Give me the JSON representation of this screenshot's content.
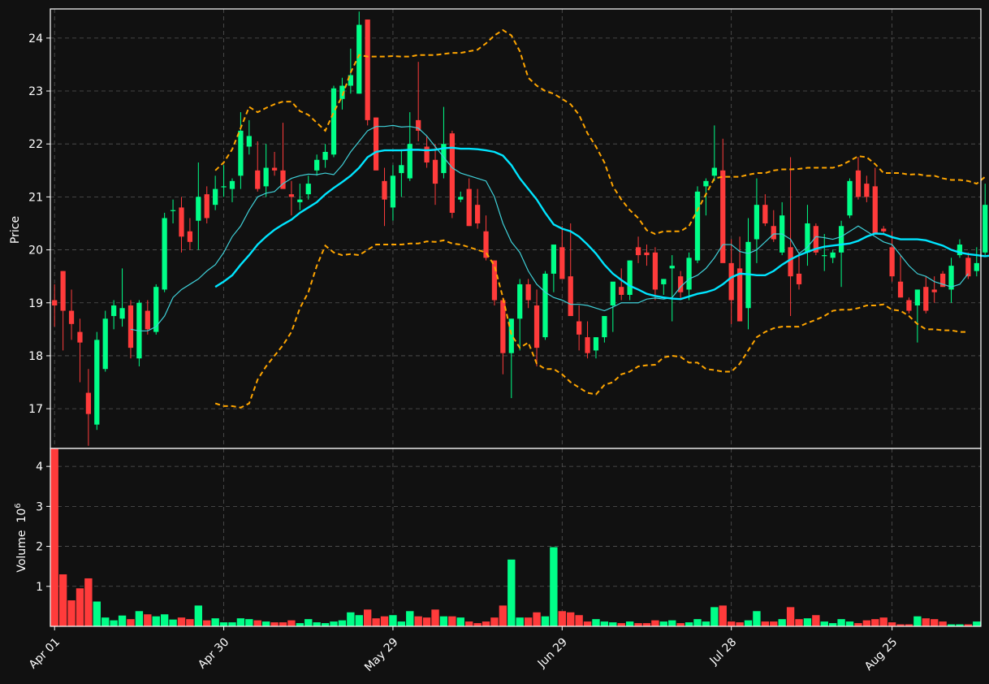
{
  "chart_data": [
    {
      "type": "candlestick",
      "panel": "price",
      "ylabel": "Price",
      "ylim": [
        16.25,
        24.55
      ],
      "yticks": [
        17,
        18,
        19,
        20,
        21,
        22,
        23,
        24
      ],
      "xlim": [
        -0.5,
        109.5
      ],
      "xtick_positions": [
        0,
        20,
        40,
        60,
        80,
        99
      ],
      "xtick_labels": [
        "Apr 01",
        "Apr 30",
        "May 29",
        "Jun 29",
        "Jul 28",
        "Aug 25"
      ],
      "grid": true,
      "colors": {
        "up": "#00ff88",
        "down": "#ff3b3b",
        "ma_fast": "#3fd0d8",
        "ma_slow": "#00e5ff",
        "bands": "#ffa500",
        "background": "#111111",
        "grid": "#555555"
      },
      "ohlc": [
        [
          19.05,
          19.35,
          18.55,
          18.95
        ],
        [
          19.6,
          19.6,
          18.1,
          18.85
        ],
        [
          18.85,
          19.25,
          18.3,
          18.6
        ],
        [
          18.45,
          18.7,
          17.5,
          18.25
        ],
        [
          17.3,
          17.75,
          16.3,
          16.9
        ],
        [
          16.7,
          18.45,
          16.6,
          18.3
        ],
        [
          17.75,
          18.85,
          17.7,
          18.7
        ],
        [
          18.75,
          19.05,
          18.5,
          18.95
        ],
        [
          18.7,
          19.65,
          18.55,
          18.9
        ],
        [
          18.95,
          19.05,
          17.95,
          18.15
        ],
        [
          17.95,
          19.05,
          17.8,
          19.0
        ],
        [
          18.85,
          19.05,
          18.4,
          18.5
        ],
        [
          18.45,
          19.35,
          18.4,
          19.3
        ],
        [
          19.25,
          20.7,
          19.2,
          20.6
        ],
        [
          20.75,
          20.95,
          20.5,
          20.75
        ],
        [
          20.8,
          21.0,
          19.95,
          20.25
        ],
        [
          20.35,
          20.6,
          20.0,
          20.15
        ],
        [
          20.55,
          21.65,
          20.0,
          21.0
        ],
        [
          21.05,
          21.2,
          20.5,
          20.6
        ],
        [
          20.85,
          21.4,
          20.75,
          21.15
        ],
        [
          21.2,
          21.6,
          21.0,
          21.2
        ],
        [
          21.15,
          21.35,
          20.9,
          21.3
        ],
        [
          21.4,
          22.6,
          21.15,
          22.25
        ],
        [
          21.95,
          22.45,
          21.8,
          22.15
        ],
        [
          21.5,
          22.05,
          21.1,
          21.15
        ],
        [
          21.2,
          22.0,
          21.0,
          21.55
        ],
        [
          21.55,
          21.85,
          21.4,
          21.5
        ],
        [
          21.5,
          22.4,
          21.2,
          21.15
        ],
        [
          21.05,
          21.3,
          20.65,
          21.0
        ],
        [
          20.9,
          21.25,
          20.75,
          20.95
        ],
        [
          21.05,
          21.4,
          20.95,
          21.25
        ],
        [
          21.5,
          21.8,
          21.4,
          21.7
        ],
        [
          21.7,
          22.0,
          21.55,
          21.85
        ],
        [
          21.8,
          23.1,
          21.75,
          23.05
        ],
        [
          22.85,
          23.25,
          22.65,
          23.1
        ],
        [
          23.1,
          23.8,
          22.95,
          23.3
        ],
        [
          22.95,
          24.5,
          22.95,
          24.25
        ],
        [
          24.35,
          24.35,
          22.35,
          22.45
        ],
        [
          22.5,
          22.5,
          21.5,
          21.5
        ],
        [
          21.3,
          21.55,
          20.45,
          20.95
        ],
        [
          20.8,
          21.6,
          20.55,
          21.4
        ],
        [
          21.45,
          21.9,
          21.0,
          21.6
        ],
        [
          21.35,
          22.6,
          21.3,
          22.0
        ],
        [
          22.45,
          23.55,
          22.05,
          22.25
        ],
        [
          21.95,
          22.15,
          21.55,
          21.65
        ],
        [
          21.7,
          22.0,
          20.85,
          21.25
        ],
        [
          21.45,
          22.7,
          21.35,
          22.0
        ],
        [
          22.2,
          22.25,
          20.6,
          20.7
        ],
        [
          20.95,
          21.1,
          20.9,
          21.0
        ],
        [
          21.15,
          21.35,
          20.45,
          20.45
        ],
        [
          20.85,
          21.15,
          20.4,
          20.5
        ],
        [
          20.35,
          20.65,
          19.8,
          19.85
        ],
        [
          19.8,
          19.8,
          18.95,
          19.05
        ],
        [
          19.05,
          19.1,
          17.65,
          18.05
        ],
        [
          18.05,
          18.7,
          17.2,
          18.7
        ],
        [
          18.7,
          19.45,
          18.1,
          19.35
        ],
        [
          19.35,
          19.45,
          18.9,
          19.05
        ],
        [
          18.95,
          19.25,
          17.8,
          18.15
        ],
        [
          18.35,
          19.6,
          18.3,
          19.55
        ],
        [
          19.55,
          20.1,
          19.2,
          20.1
        ],
        [
          20.05,
          20.45,
          19.45,
          19.45
        ],
        [
          19.5,
          20.5,
          19.25,
          18.75
        ],
        [
          18.65,
          18.95,
          18.1,
          18.4
        ],
        [
          18.35,
          18.65,
          17.95,
          18.05
        ],
        [
          18.1,
          18.35,
          17.95,
          18.35
        ],
        [
          18.35,
          18.75,
          18.25,
          18.75
        ],
        [
          18.95,
          19.35,
          18.45,
          19.4
        ],
        [
          19.3,
          19.65,
          19.05,
          19.15
        ],
        [
          19.15,
          19.8,
          19.05,
          19.8
        ],
        [
          20.05,
          20.25,
          19.75,
          19.9
        ],
        [
          19.95,
          20.1,
          19.7,
          19.9
        ],
        [
          19.95,
          20.05,
          19.05,
          19.25
        ],
        [
          19.35,
          19.45,
          19.15,
          19.45
        ],
        [
          19.65,
          19.9,
          18.65,
          19.7
        ],
        [
          19.5,
          19.6,
          19.05,
          19.2
        ],
        [
          19.25,
          19.95,
          19.05,
          19.85
        ],
        [
          19.8,
          21.2,
          19.75,
          21.1
        ],
        [
          21.2,
          21.35,
          20.65,
          21.3
        ],
        [
          21.4,
          22.35,
          21.3,
          21.55
        ],
        [
          21.5,
          22.1,
          19.95,
          19.75
        ],
        [
          19.75,
          20.2,
          18.6,
          19.05
        ],
        [
          19.65,
          20.25,
          18.65,
          18.65
        ],
        [
          18.9,
          20.6,
          18.5,
          20.15
        ],
        [
          20.2,
          21.35,
          19.75,
          20.85
        ],
        [
          20.85,
          21.05,
          20.45,
          20.5
        ],
        [
          20.45,
          20.75,
          20.15,
          20.2
        ],
        [
          19.95,
          20.9,
          19.9,
          20.65
        ],
        [
          20.05,
          21.75,
          18.75,
          19.5
        ],
        [
          19.55,
          19.95,
          19.25,
          19.35
        ],
        [
          19.95,
          20.85,
          19.7,
          20.5
        ],
        [
          20.45,
          20.5,
          19.9,
          19.95
        ],
        [
          19.9,
          20.3,
          19.6,
          19.9
        ],
        [
          19.85,
          20.0,
          19.75,
          19.95
        ],
        [
          19.95,
          20.55,
          19.3,
          20.45
        ],
        [
          20.65,
          21.35,
          20.6,
          21.3
        ],
        [
          21.5,
          21.75,
          20.95,
          21.0
        ],
        [
          21.25,
          21.4,
          20.9,
          21.0
        ],
        [
          21.2,
          21.55,
          20.35,
          20.3
        ],
        [
          20.4,
          20.45,
          20.3,
          20.35
        ],
        [
          20.05,
          20.35,
          19.4,
          19.5
        ],
        [
          19.4,
          19.9,
          19.1,
          19.1
        ],
        [
          19.05,
          19.1,
          18.8,
          18.85
        ],
        [
          18.95,
          19.25,
          18.25,
          19.25
        ],
        [
          19.3,
          19.5,
          18.8,
          18.85
        ],
        [
          19.25,
          19.5,
          19.0,
          19.2
        ],
        [
          19.55,
          19.6,
          19.3,
          19.3
        ],
        [
          19.25,
          19.85,
          19.0,
          19.7
        ],
        [
          19.9,
          20.2,
          19.85,
          20.1
        ],
        [
          19.85,
          19.95,
          19.45,
          19.5
        ],
        [
          19.6,
          20.05,
          19.5,
          19.75
        ],
        [
          19.95,
          21.25,
          19.9,
          20.85
        ]
      ],
      "ma_fast": [
        null,
        null,
        null,
        null,
        null,
        null,
        null,
        null,
        null,
        18.5,
        18.47,
        18.47,
        18.55,
        18.75,
        19.1,
        19.25,
        19.35,
        19.45,
        19.6,
        19.72,
        19.95,
        20.25,
        20.45,
        20.75,
        21.0,
        21.07,
        21.1,
        21.25,
        21.35,
        21.4,
        21.43,
        21.42,
        21.45,
        21.42,
        21.6,
        21.85,
        22.05,
        22.25,
        22.33,
        22.33,
        22.35,
        22.32,
        22.33,
        22.3,
        22.15,
        21.95,
        21.75,
        21.55,
        21.45,
        21.4,
        21.35,
        21.3,
        21.0,
        20.5,
        20.15,
        19.95,
        19.6,
        19.35,
        19.2,
        19.1,
        19.05,
        18.97,
        18.97,
        18.95,
        18.9,
        18.85,
        18.92,
        19.0,
        19.0,
        19.0,
        19.07,
        19.09,
        19.07,
        19.1,
        19.3,
        19.45,
        19.52,
        19.65,
        19.85,
        20.1,
        20.1,
        19.97,
        19.93,
        20.0,
        20.15,
        20.3,
        20.3,
        20.2,
        19.93,
        20.05,
        20.25,
        20.23,
        20.2,
        20.25,
        20.35,
        20.45,
        20.35,
        20.25,
        20.15,
        20.1,
        19.9,
        19.7,
        19.55,
        19.5,
        19.4,
        19.35,
        19.3,
        19.35,
        19.55
      ],
      "ma_slow": [
        null,
        null,
        null,
        null,
        null,
        null,
        null,
        null,
        null,
        null,
        null,
        null,
        null,
        null,
        null,
        null,
        null,
        null,
        null,
        19.3,
        19.4,
        19.52,
        19.72,
        19.9,
        20.1,
        20.25,
        20.38,
        20.48,
        20.57,
        20.7,
        20.8,
        20.9,
        21.05,
        21.17,
        21.28,
        21.4,
        21.55,
        21.75,
        21.85,
        21.88,
        21.88,
        21.88,
        21.89,
        21.89,
        21.88,
        21.89,
        21.92,
        21.93,
        21.91,
        21.91,
        21.9,
        21.88,
        21.85,
        21.78,
        21.6,
        21.35,
        21.15,
        20.95,
        20.7,
        20.48,
        20.4,
        20.35,
        20.25,
        20.1,
        19.93,
        19.72,
        19.55,
        19.43,
        19.32,
        19.25,
        19.17,
        19.13,
        19.1,
        19.08,
        19.07,
        19.12,
        19.17,
        19.2,
        19.25,
        19.35,
        19.48,
        19.55,
        19.54,
        19.52,
        19.52,
        19.6,
        19.72,
        19.82,
        19.9,
        19.96,
        20.02,
        20.06,
        20.08,
        20.1,
        20.12,
        20.17,
        20.25,
        20.31,
        20.3,
        20.24,
        20.2,
        20.2,
        20.2,
        20.18,
        20.13,
        20.08,
        20.0,
        19.95,
        19.92,
        19.9,
        19.88,
        19.9,
        19.85,
        19.88
      ],
      "band_upper": [
        null,
        null,
        null,
        null,
        null,
        null,
        null,
        null,
        null,
        null,
        null,
        null,
        null,
        null,
        null,
        null,
        null,
        null,
        null,
        21.5,
        21.65,
        21.9,
        22.3,
        22.7,
        22.6,
        22.68,
        22.75,
        22.8,
        22.8,
        22.62,
        22.55,
        22.4,
        22.25,
        22.6,
        22.9,
        23.35,
        23.68,
        23.65,
        23.65,
        23.65,
        23.66,
        23.65,
        23.65,
        23.68,
        23.68,
        23.68,
        23.7,
        23.72,
        23.72,
        23.75,
        23.78,
        23.9,
        24.05,
        24.15,
        24.05,
        23.75,
        23.25,
        23.1,
        23.0,
        22.95,
        22.85,
        22.75,
        22.55,
        22.2,
        21.95,
        21.65,
        21.2,
        20.95,
        20.75,
        20.6,
        20.37,
        20.3,
        20.35,
        20.35,
        20.35,
        20.45,
        20.75,
        21.05,
        21.35,
        21.38,
        21.38,
        21.38,
        21.42,
        21.45,
        21.45,
        21.5,
        21.52,
        21.52,
        21.53,
        21.55,
        21.55,
        21.55,
        21.55,
        21.6,
        21.68,
        21.77,
        21.75,
        21.62,
        21.45,
        21.45,
        21.45,
        21.42,
        21.43,
        21.4,
        21.4,
        21.35,
        21.32,
        21.32,
        21.3,
        21.25,
        21.38
      ],
      "band_lower": [
        null,
        null,
        null,
        null,
        null,
        null,
        null,
        null,
        null,
        null,
        null,
        null,
        null,
        null,
        null,
        null,
        null,
        null,
        null,
        17.1,
        17.05,
        17.05,
        17.02,
        17.1,
        17.55,
        17.8,
        18.0,
        18.2,
        18.45,
        18.9,
        19.2,
        19.7,
        20.08,
        19.95,
        19.9,
        19.92,
        19.9,
        20.0,
        20.1,
        20.1,
        20.1,
        20.1,
        20.12,
        20.12,
        20.16,
        20.15,
        20.18,
        20.12,
        20.1,
        20.05,
        20.0,
        19.95,
        19.7,
        19.1,
        18.4,
        18.15,
        18.25,
        17.85,
        17.75,
        17.75,
        17.65,
        17.5,
        17.4,
        17.3,
        17.27,
        17.45,
        17.5,
        17.65,
        17.7,
        17.8,
        17.82,
        17.83,
        17.97,
        18.0,
        17.98,
        17.87,
        17.87,
        17.75,
        17.73,
        17.7,
        17.7,
        17.85,
        18.1,
        18.35,
        18.45,
        18.52,
        18.55,
        18.55,
        18.55,
        18.62,
        18.68,
        18.75,
        18.85,
        18.87,
        18.87,
        18.9,
        18.95,
        18.95,
        18.97,
        18.87,
        18.85,
        18.75,
        18.6,
        18.5,
        18.5,
        18.48,
        18.48,
        18.45,
        18.45
      ]
    },
    {
      "type": "bar",
      "panel": "volume",
      "ylabel_text": "Volume",
      "ylabel_exponent": "6",
      "ylabel_base": "10",
      "ylim": [
        0,
        4.45
      ],
      "yticks": [
        1,
        2,
        3,
        4
      ],
      "grid": true,
      "values": [
        4.45,
        1.3,
        0.65,
        0.95,
        1.2,
        0.62,
        0.22,
        0.15,
        0.27,
        0.18,
        0.38,
        0.3,
        0.25,
        0.3,
        0.17,
        0.22,
        0.18,
        0.52,
        0.15,
        0.2,
        0.1,
        0.1,
        0.2,
        0.18,
        0.15,
        0.12,
        0.1,
        0.1,
        0.15,
        0.08,
        0.18,
        0.1,
        0.08,
        0.12,
        0.15,
        0.35,
        0.28,
        0.42,
        0.2,
        0.25,
        0.28,
        0.12,
        0.38,
        0.25,
        0.22,
        0.42,
        0.25,
        0.25,
        0.22,
        0.12,
        0.08,
        0.12,
        0.22,
        0.52,
        1.67,
        0.22,
        0.22,
        0.35,
        0.25,
        1.98,
        0.38,
        0.35,
        0.28,
        0.12,
        0.18,
        0.12,
        0.1,
        0.08,
        0.12,
        0.08,
        0.08,
        0.15,
        0.12,
        0.15,
        0.08,
        0.1,
        0.18,
        0.12,
        0.48,
        0.52,
        0.12,
        0.1,
        0.15,
        0.38,
        0.12,
        0.12,
        0.18,
        0.48,
        0.18,
        0.2,
        0.28,
        0.12,
        0.08,
        0.18,
        0.12,
        0.08,
        0.15,
        0.18,
        0.22,
        0.1,
        0.05,
        0.05,
        0.25,
        0.2,
        0.18,
        0.12,
        0.05,
        0.05,
        0.05,
        0.12
      ]
    }
  ]
}
